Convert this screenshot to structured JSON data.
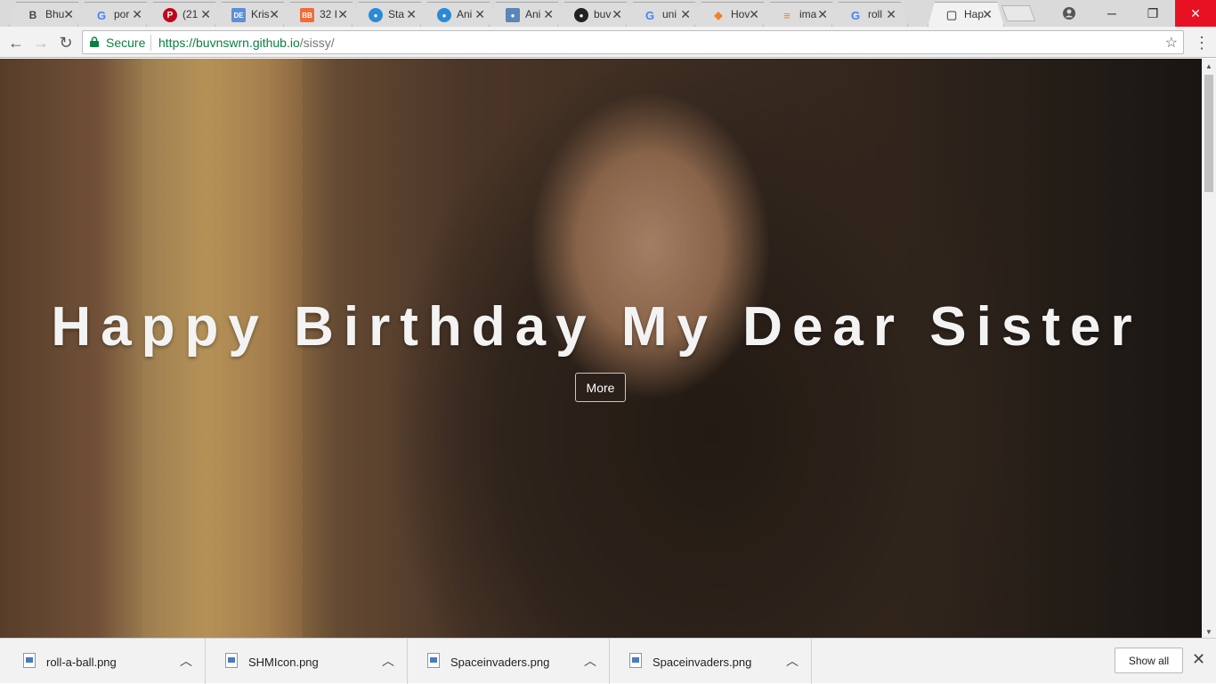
{
  "tabs": [
    {
      "title": "Bhu",
      "favicon": "bootstrap-icon",
      "favicon_text": "B",
      "color": "#dcdcdc"
    },
    {
      "title": "por",
      "favicon": "google-icon",
      "favicon_text": "G",
      "color": "#4285f4"
    },
    {
      "title": "(21",
      "favicon": "pinterest-icon",
      "favicon_text": "P",
      "color": "#bd081c"
    },
    {
      "title": "Kris",
      "favicon": "de-icon",
      "favicon_text": "DE",
      "color": "#5b8fd6"
    },
    {
      "title": "32 I",
      "favicon": "bb-icon",
      "favicon_text": "BB",
      "color": "#f26b3a"
    },
    {
      "title": "Sta",
      "favicon": "drop-icon",
      "favicon_text": "●",
      "color": "#2a8ad6"
    },
    {
      "title": "Ani",
      "favicon": "drop-icon",
      "favicon_text": "●",
      "color": "#2a8ad6"
    },
    {
      "title": "Ani",
      "favicon": "drop-icon",
      "favicon_text": "●",
      "color": "#5a86b8"
    },
    {
      "title": "buv",
      "favicon": "github-icon",
      "favicon_text": "●",
      "color": "#222222"
    },
    {
      "title": "uni",
      "favicon": "google-icon",
      "favicon_text": "G",
      "color": "#4285f4"
    },
    {
      "title": "Hov",
      "favicon": "code-icon",
      "favicon_text": "◆",
      "color": "#f48024"
    },
    {
      "title": "ima",
      "favicon": "stack-icon",
      "favicon_text": "≡",
      "color": "#f48024"
    },
    {
      "title": "roll",
      "favicon": "google-icon",
      "favicon_text": "G",
      "color": "#4285f4"
    },
    {
      "title": "Hap",
      "favicon": "page-icon",
      "favicon_text": "▢",
      "color": "#666666"
    }
  ],
  "toolbar": {
    "secure_label": "Secure",
    "url_host": "https://buvnswrn.github.io",
    "url_path": "/sissy/"
  },
  "hero": {
    "title": "Happy Birthday My Dear Sister",
    "button_label": "More"
  },
  "downloads": [
    {
      "name": "roll-a-ball.png"
    },
    {
      "name": "SHMIcon.png"
    },
    {
      "name": "Spaceinvaders.png"
    },
    {
      "name": "Spaceinvaders.png"
    }
  ],
  "shelf": {
    "show_all_label": "Show all"
  },
  "colors": {
    "secure_green": "#0b8043",
    "close_red": "#e81123"
  }
}
